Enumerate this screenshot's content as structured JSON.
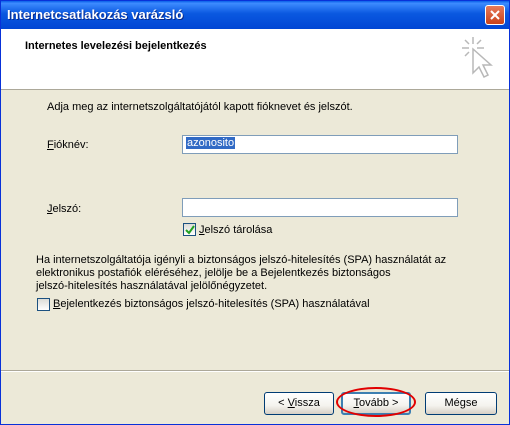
{
  "window": {
    "title": "Internetcsatlakozás varázsló"
  },
  "header": {
    "title": "Internetes levelezési bejelentkezés"
  },
  "content": {
    "intro": "Adja meg az internetszolgáltatójától kapott fióknevet és jelszót.",
    "account_label_hot": "F",
    "account_label_rest": "ióknév:",
    "account_value": "azonosito",
    "password_label_hot": "J",
    "password_label_rest": "elszó:",
    "password_value": "",
    "remember_hot": "J",
    "remember_rest": "elszó tárolása",
    "remember_checked": true,
    "spa_line1": "Ha internetszolgáltatója igényli a biztonságos jelszó-hitelesítés (SPA) használatát az",
    "spa_line2": "elektronikus postafiók eléréséhez, jelölje be a Bejelentkezés biztonságos",
    "spa_line3": "jelszó-hitelesítés használatával jelölőnégyzetet.",
    "spa_checkbox_hot": "B",
    "spa_checkbox_rest": "ejelentkezés biztonságos jelszó-hitelesítés (SPA) használatával",
    "spa_checked": false
  },
  "buttons": {
    "back_pre": "< ",
    "back_hot": "V",
    "back_rest": "issza",
    "next_hot": "T",
    "next_rest": "ovább >",
    "cancel": "Mégse"
  },
  "colors": {
    "title_bar": "#0a58e0",
    "selection": "#316ac5",
    "highlight_ellipse": "#e10000"
  }
}
